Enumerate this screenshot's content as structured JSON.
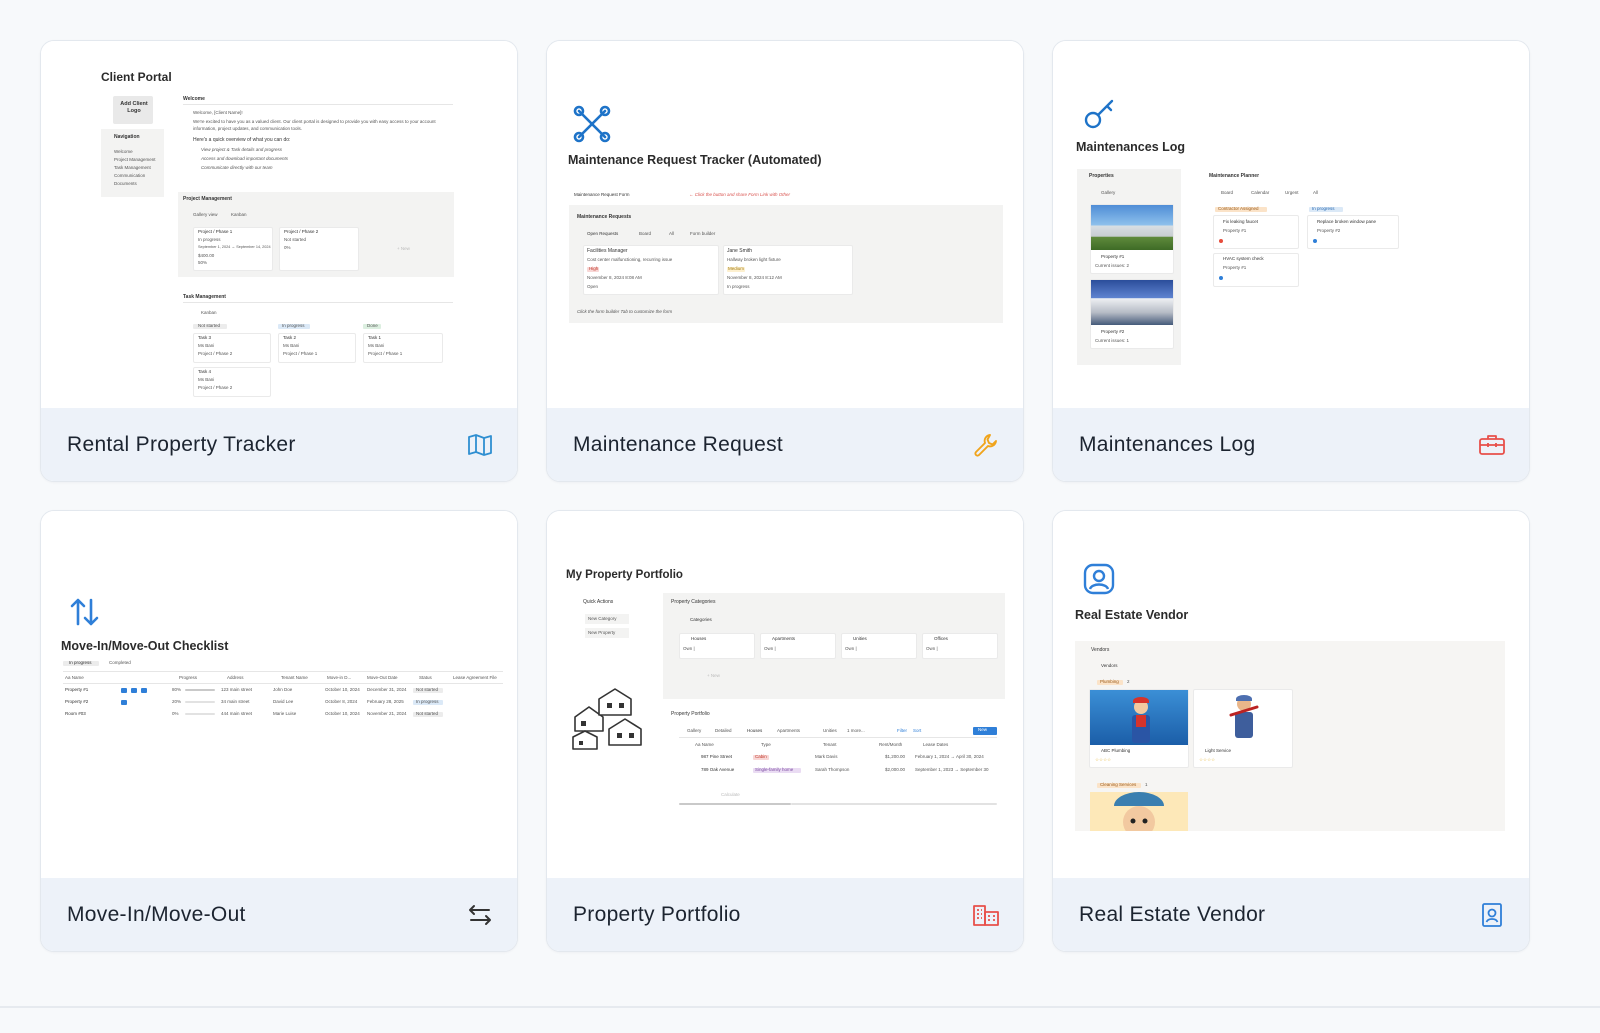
{
  "cards": [
    {
      "title": "Rental Property Tracker",
      "icon": "map-icon",
      "icon_color": "#2f8fd1",
      "preview": {
        "heading": "Client Portal",
        "logo_label": "Add Client Logo",
        "nav_title": "Navigation",
        "nav_items": [
          "Welcome",
          "Project Management",
          "Task Management",
          "Communication",
          "Documents"
        ],
        "welcome_title": "Welcome",
        "welcome_greeting": "Welcome, [Client Name]!",
        "welcome_text": "We're excited to have you as a valued client. Our client portal is designed to provide you with easy access to your account information, project updates, and communication tools.",
        "welcome_subtitle": "Here's a quick overview of what you can do:",
        "welcome_bullets": [
          "View project & Task details and progress",
          "Access and download important documents",
          "Communicate directly with our team"
        ],
        "project_title": "Project Management",
        "project_tabs": [
          "Gallery view",
          "Kanban"
        ],
        "projects": [
          {
            "name": "Project / Phase 1",
            "status": "In progress",
            "dates": "September 1, 2024 → September 14, 2024",
            "amount": "$400.00",
            "progress": "50%"
          },
          {
            "name": "Project / Phase 2",
            "status": "Not started",
            "dates": "",
            "amount": "",
            "progress": "0%"
          }
        ],
        "new_label": "+ New",
        "task_title": "Task Management",
        "task_view": "Kanban",
        "task_columns": [
          {
            "status": "Not started",
            "tasks": [
              {
                "name": "Task 3",
                "owner": "Ms Bani",
                "project": "Project / Phase 2"
              },
              {
                "name": "Task 4",
                "owner": "Ms Bani",
                "project": "Project / Phase 2"
              }
            ]
          },
          {
            "status": "In progress",
            "tasks": [
              {
                "name": "Task 2",
                "owner": "Ms Bani",
                "project": "Project / Phase 1"
              }
            ]
          },
          {
            "status": "Done",
            "tasks": [
              {
                "name": "Task 1",
                "owner": "Ms Bani",
                "project": "Project / Phase 1"
              }
            ]
          }
        ]
      }
    },
    {
      "title": "Maintenance Request",
      "icon": "wrench-icon",
      "icon_color": "#f0a41c",
      "preview": {
        "heading": "Maintenance Request Tracker (Automated)",
        "form_button": "Maintenance Request Form",
        "hint": "← Click the button and share Form Link with Other",
        "db_title": "Maintenance Requests",
        "tabs": [
          "Open Requests",
          "Board",
          "All",
          "Form builder"
        ],
        "requests": [
          {
            "name": "Facilities Manager",
            "desc": "Cost center malfunctioning, recurring issue",
            "priority": "High",
            "date": "November 8, 2024 8:08 AM",
            "status": "Open"
          },
          {
            "name": "Jane Smith",
            "desc": "Hallway broken light fixture",
            "priority": "Medium",
            "date": "November 8, 2024 8:12 AM",
            "status": "In progress"
          }
        ],
        "footer_note": "Click the form builder Tab to customize the form"
      }
    },
    {
      "title": "Maintenances Log",
      "icon": "toolbox-icon",
      "icon_color": "#e8504a",
      "preview": {
        "heading": "Maintenances Log",
        "properties_title": "Properties",
        "gallery_tab": "Gallery",
        "properties": [
          {
            "name": "Property #1",
            "issues": "Current issues: 2"
          },
          {
            "name": "Property #2",
            "issues": "Current issues: 1"
          }
        ],
        "planner_title": "Maintenance Planner",
        "planner_tabs": [
          "Board",
          "Calendar",
          "Urgent",
          "All"
        ],
        "columns": [
          {
            "status": "Contractor Assigned",
            "items": [
              {
                "name": "Fix leaking faucet",
                "property": "Property #1"
              },
              {
                "name": "HVAC system check",
                "property": "Property #1"
              }
            ]
          },
          {
            "status": "In progress",
            "items": [
              {
                "name": "Replace broken window pane",
                "property": "Property #2"
              }
            ]
          }
        ]
      }
    },
    {
      "title": "Move-In/Move-Out",
      "icon": "swap-arrows-icon",
      "icon_color": "#333333",
      "preview": {
        "heading": "Move-In/Move-Out Checklist",
        "header_icon_color": "#2f7fd8",
        "tabs": [
          "In progress",
          "Completed"
        ],
        "columns": [
          "Aa Name",
          "Progress",
          "Address",
          "Tenant Name",
          "Move-in D...",
          "Move-Out Date",
          "Status",
          "Lease Agreement File"
        ],
        "rows": [
          {
            "name": "Property #1",
            "progress": "80%",
            "address": "123 main street",
            "tenant": "John Doe",
            "move_in": "October 10, 2024",
            "move_out": "December 31, 2024",
            "status": "Not started"
          },
          {
            "name": "Property #2",
            "progress": "20%",
            "address": "34 main street",
            "tenant": "David Lee",
            "move_in": "October 8, 2024",
            "move_out": "February 28, 2025",
            "status": "In progress"
          },
          {
            "name": "Room #03",
            "progress": "0%",
            "address": "444 main street",
            "tenant": "Marie Luise",
            "move_in": "October 10, 2024",
            "move_out": "November 21, 2024",
            "status": "Not started"
          }
        ]
      }
    },
    {
      "title": "Property Portfolio",
      "icon": "buildings-icon",
      "icon_color": "#e8504a",
      "preview": {
        "heading": "My Property Portfolio",
        "quick_title": "Quick Actions",
        "quick_buttons": [
          "New Category",
          "New Property"
        ],
        "categories_title": "Property Categories",
        "categories_tab": "Categories",
        "categories": [
          {
            "name": "Houses",
            "count": "Own |"
          },
          {
            "name": "Apartments",
            "count": "Own |"
          },
          {
            "name": "Unities",
            "count": "Own |"
          },
          {
            "name": "Offices",
            "count": "Own |"
          }
        ],
        "new_label": "+ New",
        "portfolio_title": "Property Portfolio",
        "portfolio_tabs": [
          "Gallery",
          "Detailed",
          "Houses",
          "Apartments",
          "Unities",
          "1 more..."
        ],
        "toolbar": {
          "filter": "Filter",
          "sort": "Sort",
          "new": "New"
        },
        "portfolio_columns": [
          "Aa Name",
          "Type",
          "Tenant",
          "Rent/Month",
          "Lease Dates"
        ],
        "portfolio_rows": [
          {
            "name": "987 Pine Street",
            "type": "Cabin",
            "tenant": "Mark Davis",
            "rent": "$1,200.00",
            "lease": "February 1, 2024 → April 30, 2024"
          },
          {
            "name": "789 Oak Avenue",
            "type": "Single-family home",
            "tenant": "Sarah Thompson",
            "rent": "$2,000.00",
            "lease": "September 1, 2023 → September 30"
          }
        ],
        "calculate_label": "Calculate"
      }
    },
    {
      "title": "Real Estate Vendor",
      "icon": "contact-card-icon",
      "icon_color": "#2f7fd8",
      "preview": {
        "heading": "Real Estate Vendor",
        "header_icon_color": "#2f7fd8",
        "db_title": "Vendors",
        "tab": "Vendors",
        "groups": [
          {
            "name": "Plumbing",
            "count": "2",
            "vendors": [
              {
                "name": "ABC Plumbing",
                "rating": "☆☆☆☆"
              },
              {
                "name": "Light Service",
                "rating": "☆☆☆☆"
              }
            ]
          },
          {
            "name": "Cleaning Services",
            "count": "1",
            "vendors": []
          }
        ]
      }
    }
  ]
}
